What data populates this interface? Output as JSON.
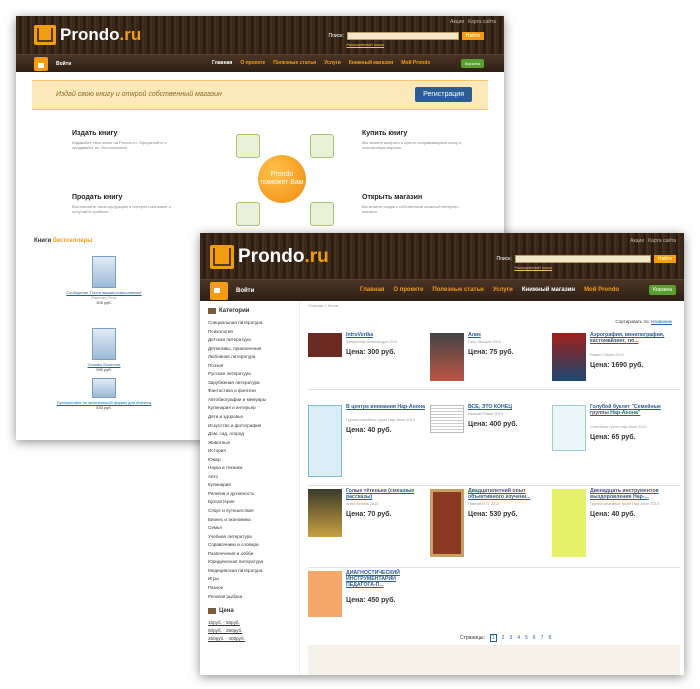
{
  "back": {
    "brand": {
      "name": "Prondo",
      "tld": ".ru"
    },
    "toplinks": [
      "Акции",
      "Карта сайта"
    ],
    "search": {
      "label": "Поиск:",
      "button": "Найти",
      "advanced": "Расширенный поиск"
    },
    "nav": {
      "login": "Войти",
      "items": [
        "Главная",
        "О проекте",
        "Полезные статьи",
        "Услуги",
        "Книжный магазин",
        "Мой Prondo"
      ],
      "cart": "Корзина"
    },
    "banner": {
      "slogan": "Издай свою книгу и открой собственный магазин",
      "register": "Регистрация"
    },
    "features": [
      {
        "title": "Издать книгу",
        "text": "Издавайте свои книги на Prondo.ru. Оформляйте и продавайте их, без вложений."
      },
      {
        "title": "Купить книгу",
        "text": "Мы можете выбрать и купить понравившуюся книгу и электронную версию."
      },
      {
        "title": "Продать книгу",
        "text": "Выставляйте свою продукцию в интернет-магазине и получайте прибыль."
      },
      {
        "title": "Открыть магазин",
        "text": "Вы можете создать собственный книжный интернет-магазин."
      }
    ],
    "hub": "Prondo поможет Вам",
    "bestsellers": {
      "label": "Книги",
      "highlight": "бестселлеры"
    },
    "books": [
      {
        "title": "Сообщение 'Почти вашим-помошником!'",
        "author": "Ракетин Петр",
        "price": "305 руб."
      },
      {
        "title": "Основы биологии",
        "author": "",
        "price": "990 руб."
      },
      {
        "title": "Путешествие по экзотической формы для бизнеса",
        "author": "",
        "price": "530 руб."
      }
    ]
  },
  "front": {
    "brand": {
      "name": "Prondo",
      "tld": ".ru"
    },
    "toplinks": [
      "Акции",
      "Карта сайта"
    ],
    "search": {
      "label": "Поиск:",
      "button": "Найти",
      "advanced": "Расширенный поиск"
    },
    "nav": {
      "login": "Войти",
      "items": [
        "Главная",
        "О проекте",
        "Полезные статьи",
        "Услуги",
        "Книжный магазин",
        "Мой Prondo"
      ],
      "cart": "Корзина"
    },
    "categories_title": "Категории",
    "categories": [
      "Специальная литература",
      "Психология",
      "Детская литература",
      "Детективы, приключения",
      "Любовная литература",
      "Поэзия",
      "Русская литература",
      "Зарубежная литература",
      "Фантастика и фэнтези",
      "Автобиографии и мемуары",
      "Кулинария и интерьер",
      "Дети и здоровье",
      "Искусство и фотография",
      "Дом, сад, огород",
      "Животные",
      "История",
      "Юмор",
      "Наука и техника",
      "Авто",
      "Кулинария",
      "Религия и духовность",
      "Бухгалтерия",
      "Спорт и путешествия",
      "Бизнес и экономика",
      "Семья",
      "Учебная литература",
      "Справочники и словари",
      "Развлечения и хобби",
      "Юридическая литература",
      "Медицинская литература",
      "Игры",
      "Разное",
      "Религия рыбака"
    ],
    "price_title": "Цена",
    "price_ranges": [
      "10руб. - 50руб.",
      "50руб. - 250руб.",
      "250руб. - 400руб."
    ],
    "crumbs": "Главная > Книги",
    "sort": {
      "label": "Сортировать по:",
      "value": "Названию"
    },
    "products": [
      {
        "title": "IntroVertka",
        "author": "Февралева Александра 2013",
        "price": "Цена: 300 руб."
      },
      {
        "title": "Алик",
        "author": "Петр Эмоций 2013",
        "price": "Цена: 75 руб."
      },
      {
        "title": "Аэрография, винилография, кастомайзинг, тю...",
        "author": "Рамин Семён 2013",
        "price": "Цена: 1690 руб."
      },
      {
        "title": "В центре внимания Нар-Анона",
        "author": "Группа семейных групп Нар-Анон 2013",
        "price": "Цена: 40 руб."
      },
      {
        "title": "ВСЕ, ЭТО КОНЕЦ",
        "author": "Иванов Роман 2013",
        "price": "Цена: 400 руб."
      },
      {
        "title": "Голубой буклет \"Семейные группы Нар-Анона\"",
        "author": "Семейных групп Нар-Анон 2013",
        "price": "Цена: 65 руб."
      },
      {
        "title": "Голые тётеньки (смешные рассказы)",
        "author": "Анна Лепина 2013",
        "price": "Цена: 70 руб."
      },
      {
        "title": "Двадцатилетний опыт объективного изучени...",
        "author": "Павлов И.П. 2012",
        "price": "Цена: 530 руб."
      },
      {
        "title": "Двенадцать инструментов выздоровления Нар-...",
        "author": "Группа семейных групп Нар-Анон 2013",
        "price": "Цена: 40 руб."
      },
      {
        "title": "ДИАГНОСТИЧЕСКИЙ ИНСТРУМЕНТАРИЙ ПЕДАГОГА-П...",
        "author": "",
        "price": "Цена: 450 руб."
      }
    ],
    "pager": {
      "label": "Страницы:",
      "pages": [
        "1",
        "2",
        "3",
        "4",
        "5",
        "6",
        "7",
        "8"
      ]
    }
  }
}
